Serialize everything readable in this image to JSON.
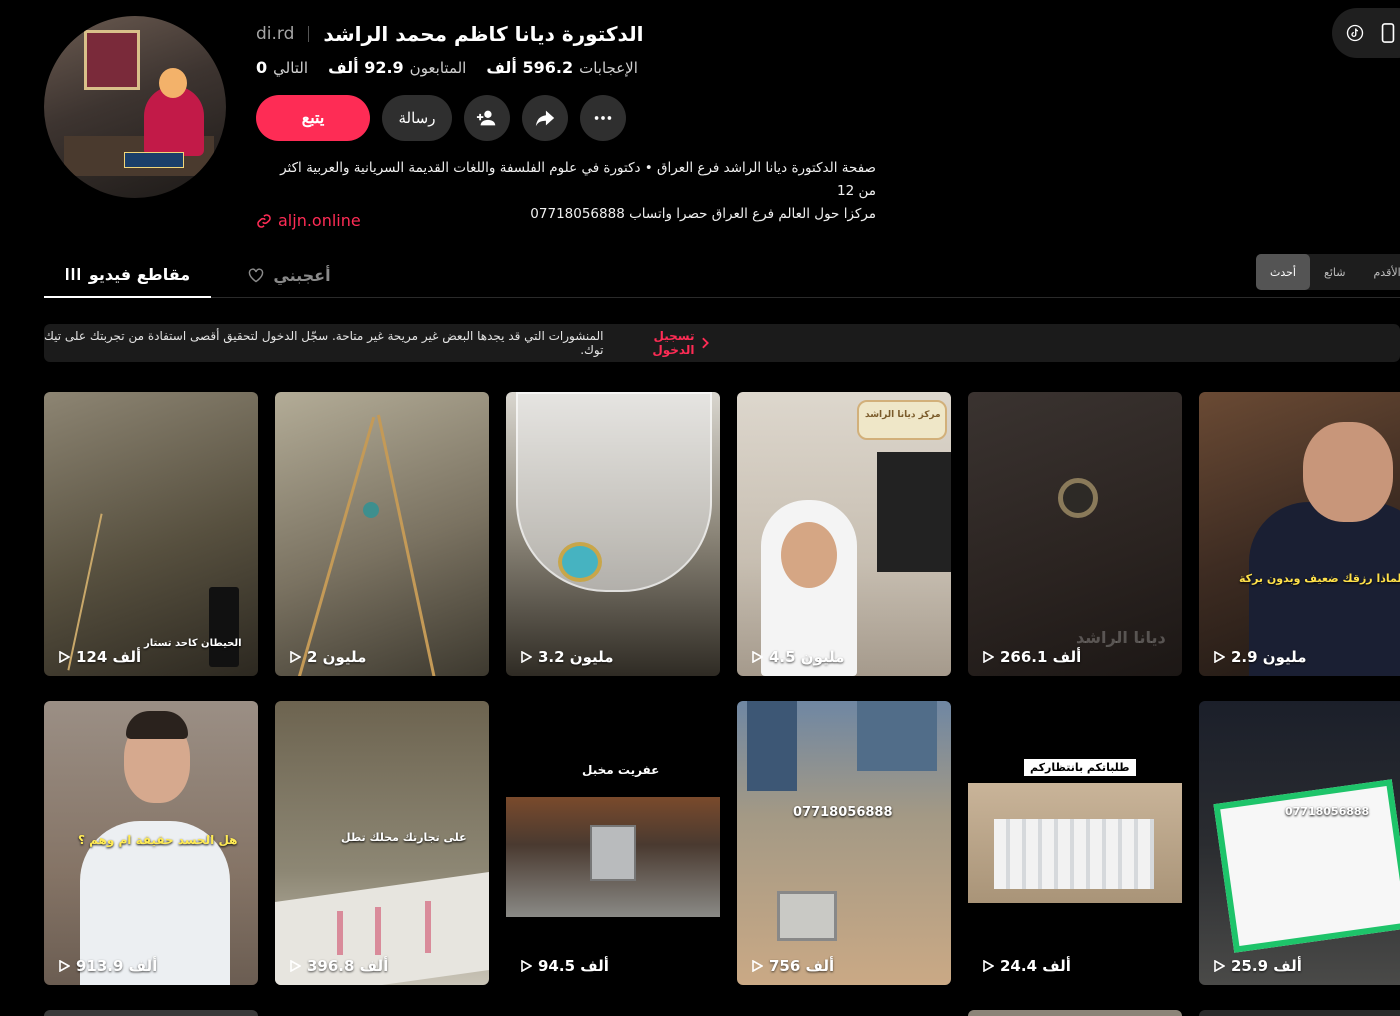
{
  "profile": {
    "display_name": "الدكتورة ديانا كاظم محمد الراشد",
    "username": "di.rd",
    "stats": {
      "likes_value": "596.2 ألف",
      "likes_label": "الإعجابات",
      "followers_value": "92.9 ألف",
      "followers_label": "المتابعون",
      "following_value": "0",
      "following_label": "التالي"
    },
    "bio_line1": "صفحة الدكتورة ديانا الراشد فرع العراق • دكتورة في علوم الفلسفة واللغات القديمة السريانية والعربية اكثر من 12",
    "bio_line2": "مركزا حول العالم فرع العراق حصرا واتساب 07718056888",
    "link": "aljn.online"
  },
  "actions": {
    "follow_label": "يتبع",
    "message_label": "رسالة",
    "add_friend_icon": "person-add-icon",
    "share_icon": "share-arrow-icon",
    "more_icon": "more-dots-icon"
  },
  "top_right": {
    "icons": [
      "tiktok-logo-icon",
      "phone-icon"
    ]
  },
  "tabs": {
    "videos": "مقاطع فيديو",
    "liked": "أعجبني"
  },
  "sort": {
    "latest": "أحدث",
    "popular": "شائع",
    "oldest": "الأقدم"
  },
  "banner": {
    "login_label": "تسجيل الدخول",
    "message": "المنشورات التي قد يجدها البعض غير مريحة غير متاحة. سجّل الدخول لتحقيق أقصى استفادة من تجربتك على تيك توك."
  },
  "videos": [
    {
      "views": "124 ألف",
      "caption": "الحيطان كاحد تستار"
    },
    {
      "views": "2 مليون",
      "caption": ""
    },
    {
      "views": "3.2 مليون",
      "caption": ""
    },
    {
      "views": "4.5 مليون",
      "caption": "مركز ديانا الراشد"
    },
    {
      "views": "266.1 ألف",
      "caption": "ديانا الراشد"
    },
    {
      "views": "2.9 مليون",
      "caption": "لماذا رزقك ضعيف وبدون بركة"
    },
    {
      "views": "913.9 ألف",
      "caption": "هل الحسد حقيقة ام وهم ؟"
    },
    {
      "views": "396.8 ألف",
      "caption": "على تجارتك محلك تطل"
    },
    {
      "views": "94.5 ألف",
      "caption": "عفريت مخبل"
    },
    {
      "views": "756 ألف",
      "caption": "07718056888"
    },
    {
      "views": "24.4 ألف",
      "caption": "طلباتكم بانتظاركم"
    },
    {
      "views": "25.9 ألف",
      "caption": "07718056888"
    }
  ],
  "colors": {
    "accent": "#fe2c55",
    "background": "#000000",
    "surface": "#2f2f2f"
  }
}
